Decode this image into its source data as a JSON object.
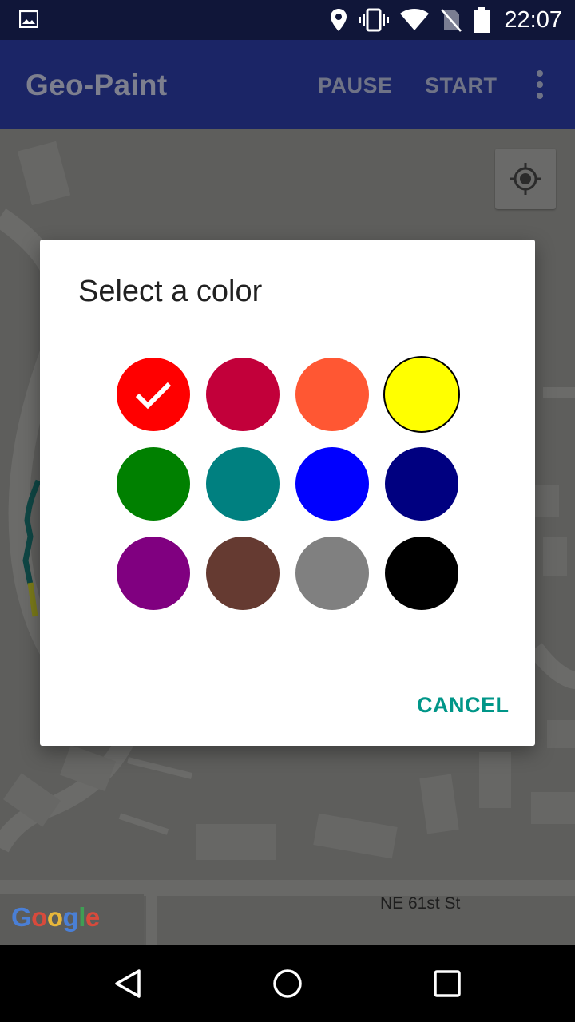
{
  "status_bar": {
    "time": "22:07",
    "icons": [
      "image-icon",
      "location-icon",
      "vibrate-icon",
      "wifi-icon",
      "no-sim-icon",
      "battery-icon"
    ]
  },
  "app_bar": {
    "title": "Geo-Paint",
    "pause_label": "PAUSE",
    "start_label": "START",
    "overflow_icon": "more-vert-icon",
    "background": "#1b2566"
  },
  "map": {
    "street_label": "NE 61st St",
    "logo_text": "Google",
    "locate_icon": "my-location-icon"
  },
  "dialog": {
    "title": "Select a color",
    "selected_color": "#ff0000",
    "colors": [
      {
        "name": "red",
        "hex": "#ff0000"
      },
      {
        "name": "crimson",
        "hex": "#c2003a"
      },
      {
        "name": "orange",
        "hex": "#ff5733"
      },
      {
        "name": "yellow",
        "hex": "#ffff00"
      },
      {
        "name": "green",
        "hex": "#008000"
      },
      {
        "name": "teal",
        "hex": "#008080"
      },
      {
        "name": "blue",
        "hex": "#0000ff"
      },
      {
        "name": "navy",
        "hex": "#000080"
      },
      {
        "name": "purple",
        "hex": "#800080"
      },
      {
        "name": "brown",
        "hex": "#653a31"
      },
      {
        "name": "gray",
        "hex": "#808080"
      },
      {
        "name": "black",
        "hex": "#000000"
      }
    ],
    "cancel_label": "CANCEL",
    "accent": "#009688"
  },
  "nav_bar": {
    "icons": [
      "back-icon",
      "home-icon",
      "recents-icon"
    ]
  }
}
